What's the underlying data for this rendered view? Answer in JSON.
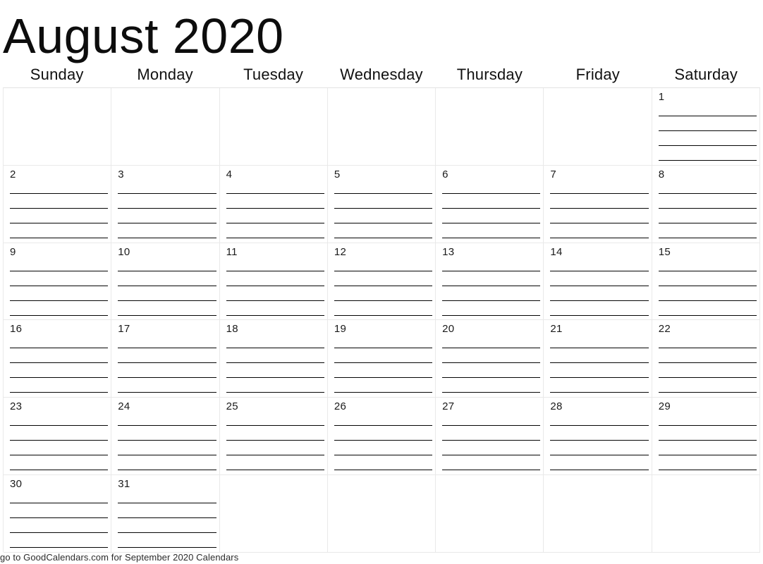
{
  "title": "August 2020",
  "month": "August",
  "year": "2020",
  "weekdays": [
    "Sunday",
    "Monday",
    "Tuesday",
    "Wednesday",
    "Thursday",
    "Friday",
    "Saturday"
  ],
  "weeks": [
    [
      "",
      "",
      "",
      "",
      "",
      "",
      "1"
    ],
    [
      "2",
      "3",
      "4",
      "5",
      "6",
      "7",
      "8"
    ],
    [
      "9",
      "10",
      "11",
      "12",
      "13",
      "14",
      "15"
    ],
    [
      "16",
      "17",
      "18",
      "19",
      "20",
      "21",
      "22"
    ],
    [
      "23",
      "24",
      "25",
      "26",
      "27",
      "28",
      "29"
    ],
    [
      "30",
      "31",
      "",
      "",
      "",
      "",
      ""
    ]
  ],
  "lines_per_cell": 4,
  "footer": {
    "text": "go to GoodCalendars.com for September 2020 Calendars"
  },
  "colors": {
    "text": "#111111",
    "grid_line": "#e9e9e9",
    "write_line": "#050505",
    "background": "#ffffff"
  }
}
